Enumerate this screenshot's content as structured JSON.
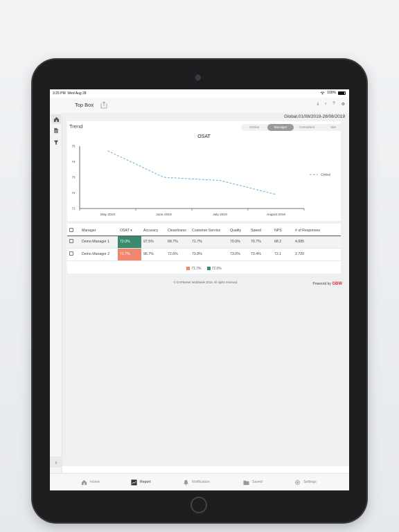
{
  "status_bar": {
    "time": "3:25 PM",
    "date": "Wed Aug 28",
    "battery": "100%"
  },
  "header": {
    "title": "Top Box"
  },
  "date_range": "Global,01/08/2019-28/08/2019",
  "trend": {
    "title": "Trend",
    "segments": [
      {
        "label": "Global",
        "active": false
      },
      {
        "label": "Manager",
        "active": true
      },
      {
        "label": "Consultant",
        "active": false
      },
      {
        "label": "Site",
        "active": false
      }
    ]
  },
  "chart_data": {
    "type": "line",
    "title": "OSAT",
    "categories": [
      "May 2019",
      "June 2019",
      "July 2019",
      "August 2019"
    ],
    "series": [
      {
        "name": "Global",
        "values": [
          74.7,
          73.0,
          72.8,
          71.9
        ],
        "color": "#6aaed6"
      }
    ],
    "ylim": [
      71,
      75
    ],
    "yticks": [
      "71",
      "72",
      "73",
      "74",
      "75"
    ],
    "legend": "right",
    "grid": false
  },
  "table": {
    "headers": [
      "Manager",
      "OSAT",
      "Accuracy",
      "Cleanliness",
      "Customer Service",
      "Quality",
      "Speed",
      "NPS",
      "# of Responses"
    ],
    "rows": [
      [
        "Demo Manager 1",
        "72.0%",
        "97.5%",
        "68.7%",
        "71.7%",
        "70.0%",
        "70.7%",
        "68.2",
        "4,685"
      ],
      [
        "Demo Manager 2",
        "71.7%",
        "96.7%",
        "72.6%",
        "73.8%",
        "73.0%",
        "73.4%",
        "72.1",
        "2,720"
      ]
    ],
    "legend": [
      {
        "label": "71.7%",
        "color": "#f2876f"
      },
      {
        "label": "72.0%",
        "color": "#3b8a6e"
      }
    ]
  },
  "footer": {
    "copyright": "© GAPbuster Worldwide 2019. All rights reserved.",
    "powered_by": "Powered by",
    "brand": "GBW"
  },
  "tabs": [
    {
      "label": "Home",
      "icon": "home-icon"
    },
    {
      "label": "Report",
      "icon": "report-icon",
      "active": true
    },
    {
      "label": "Notification",
      "icon": "bell-icon"
    },
    {
      "label": "Saved",
      "icon": "folder-icon"
    },
    {
      "label": "Settings",
      "icon": "gear-icon"
    }
  ]
}
